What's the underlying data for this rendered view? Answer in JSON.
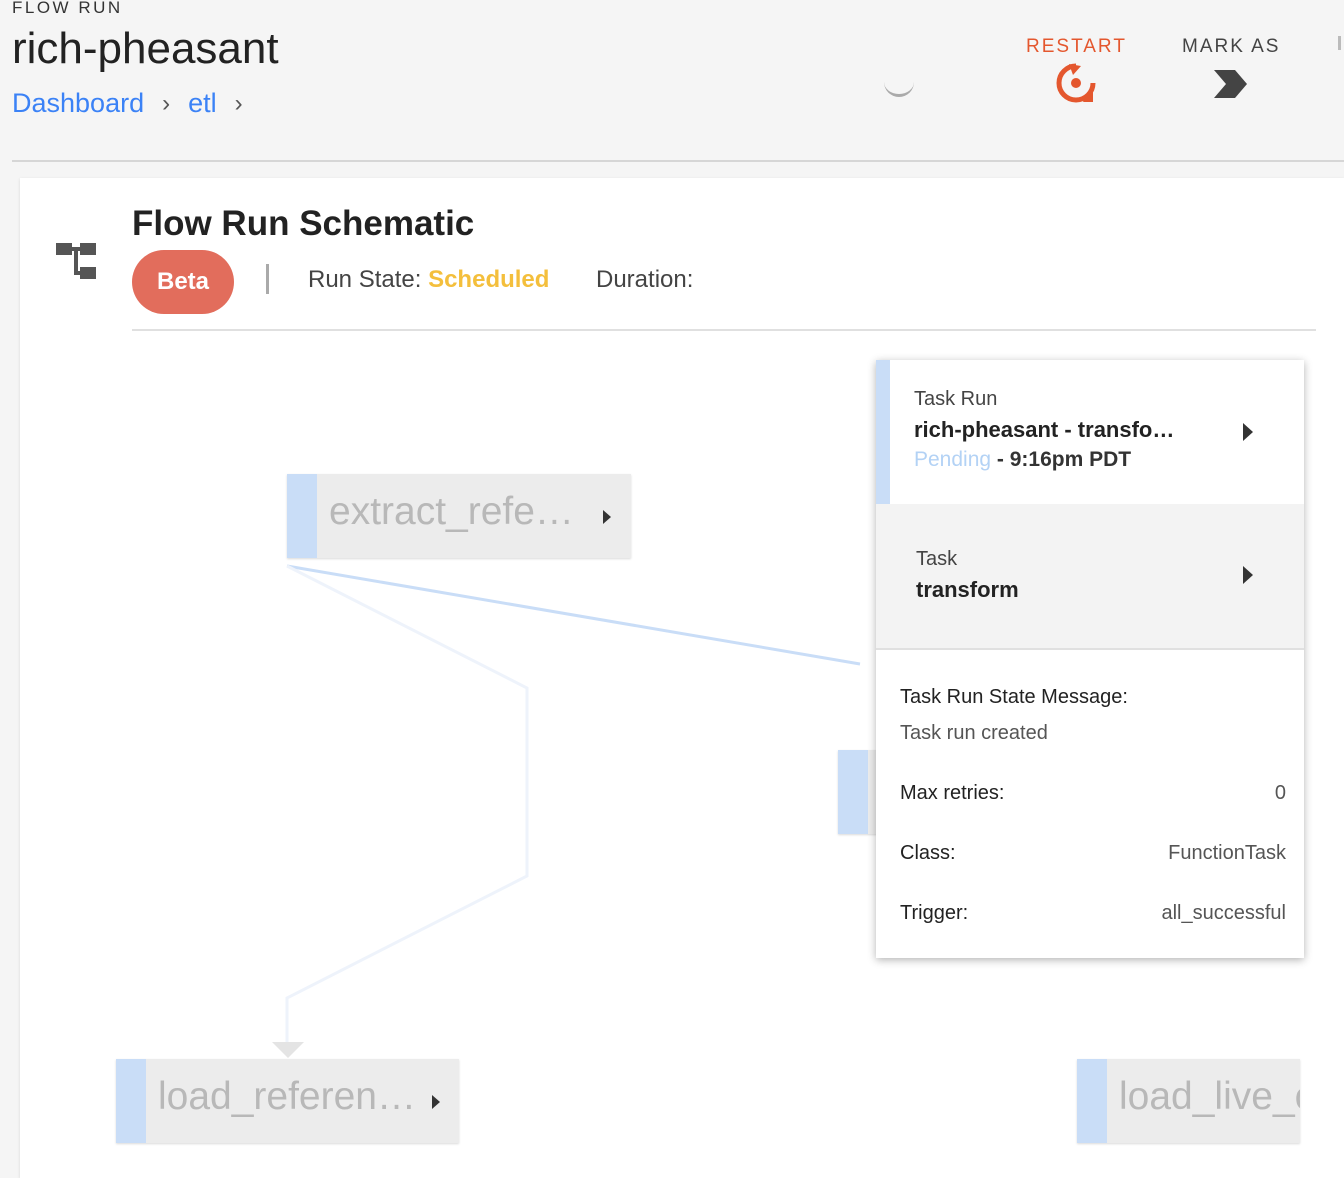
{
  "header": {
    "overline": "FLOW RUN",
    "run_name": "rich-pheasant",
    "breadcrumbs": [
      {
        "label": "Dashboard",
        "separator": "›"
      },
      {
        "label": "etl",
        "separator": "›"
      }
    ],
    "actions": {
      "restart_label": "RESTART",
      "mark_as_label": "MARK AS"
    }
  },
  "schematic": {
    "title": "Flow Run Schematic",
    "beta_label": "Beta",
    "run_state_label": "Run State:",
    "run_state_value": "Scheduled",
    "duration_label": "Duration:",
    "nodes": [
      {
        "label": "extract_refe…"
      },
      {
        "label": "load_referen…"
      },
      {
        "label": "load_live_c"
      }
    ]
  },
  "popup": {
    "task_run_heading": "Task Run",
    "task_run_name": "rich-pheasant - transfo…",
    "task_run_state": "Pending",
    "task_run_time": " - 9:16pm PDT",
    "task_heading": "Task",
    "task_name": "transform",
    "state_message_label": "Task Run State Message:",
    "state_message_value": "Task run created",
    "max_retries_label": "Max retries:",
    "max_retries_value": "0",
    "class_label": "Class:",
    "class_value": "FunctionTask",
    "trigger_label": "Trigger:",
    "trigger_value": "all_successful"
  },
  "colors": {
    "link": "#3b82f6",
    "restart": "#e4572e",
    "beta": "#e26d5c",
    "scheduled": "#f4bf3c",
    "pending": "#b3d2f5",
    "node_accent": "#c9ddf7"
  },
  "icons": [
    "chevron-right-icon",
    "restart-icon",
    "mark-as-chevron-icon",
    "schematic-icon",
    "play-arrow-icon"
  ]
}
